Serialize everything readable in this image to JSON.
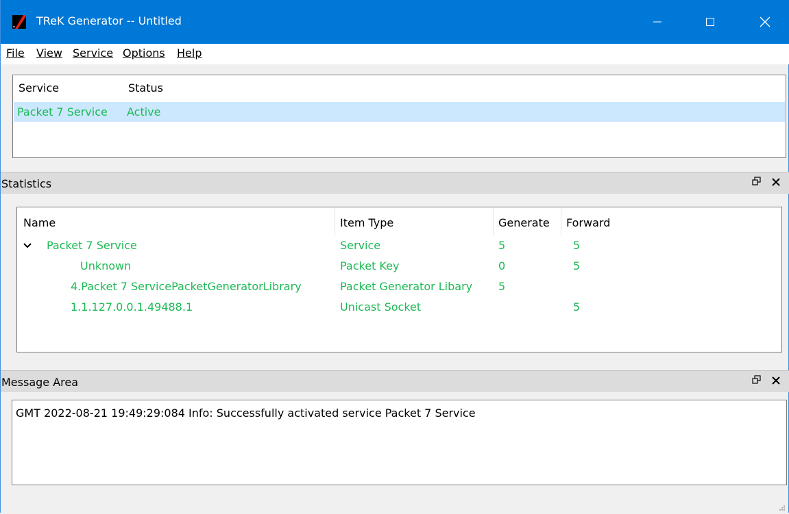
{
  "window": {
    "title": "TReK Generator -- Untitled"
  },
  "menu": {
    "file": "File",
    "view": "View",
    "service": "Service",
    "options": "Options",
    "help": "Help"
  },
  "services": {
    "headers": {
      "service": "Service",
      "status": "Status"
    },
    "rows": [
      {
        "service": "Packet 7 Service",
        "status": "Active"
      }
    ]
  },
  "statistics": {
    "title": "Statistics",
    "headers": {
      "name": "Name",
      "item_type": "Item Type",
      "generate": "Generate",
      "forward": "Forward"
    },
    "rows": [
      {
        "name": "Packet 7 Service",
        "item_type": "Service",
        "generate": "5",
        "forward": "5"
      },
      {
        "name": "Unknown",
        "item_type": "Packet Key",
        "generate": "0",
        "forward": "5"
      },
      {
        "name": "4.Packet 7 ServicePacketGeneratorLibrary",
        "item_type": "Packet Generator Libary",
        "generate": "5",
        "forward": ""
      },
      {
        "name": "1.1.127.0.0.1.49488.1",
        "item_type": "Unicast Socket",
        "generate": "",
        "forward": "5"
      }
    ]
  },
  "messages": {
    "title": "Message Area",
    "lines": [
      "GMT 2022-08-21 19:49:29:084  Info:  Successfully activated service Packet 7 Service"
    ]
  },
  "colors": {
    "titlebar": "#0078d7",
    "active_text": "#1db955",
    "selection": "#cce8ff"
  },
  "icons": [
    "app-icon",
    "minimize-icon",
    "maximize-icon",
    "close-icon",
    "chevron-down-icon",
    "float-icon",
    "dock-close-icon",
    "size-grip-icon"
  ]
}
